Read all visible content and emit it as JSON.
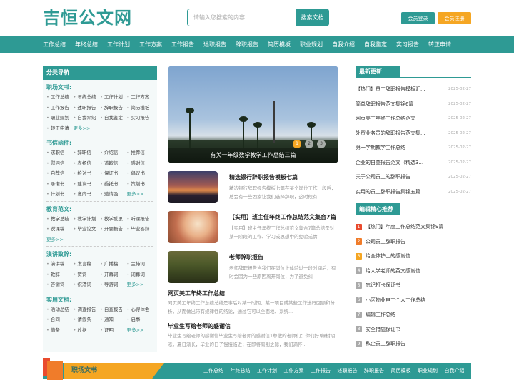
{
  "header": {
    "logo": "吉恒公文网",
    "search_placeholder": "请输入您搜索的内容",
    "search_button": "搜索文档",
    "login": "会员登录",
    "register": "会员注册"
  },
  "nav": [
    "工作总结",
    "年终总结",
    "工作计划",
    "工作方案",
    "工作报告",
    "述职报告",
    "辞职报告",
    "简历模板",
    "职业规划",
    "自我介绍",
    "自我鉴定",
    "实习报告",
    "转正申请"
  ],
  "sidebar": {
    "title": "分类导航",
    "categories": [
      {
        "title": "职场文书:",
        "items": [
          "工作总结",
          "年终总结",
          "工作计划",
          "工作方案",
          "工作报告",
          "述职报告",
          "辞职报告",
          "简历模板",
          "职业规划",
          "自我介绍",
          "自我鉴定",
          "实习报告",
          "转正申请",
          "更多>>"
        ]
      },
      {
        "title": "书信函件:",
        "items": [
          "求职信",
          "辞职信",
          "介绍信",
          "推荐信",
          "慰问信",
          "表扬信",
          "道歉信",
          "感谢信",
          "自荐信",
          "检讨书",
          "保证书",
          "倡议书",
          "承诺书",
          "建议书",
          "委托书",
          "策划书",
          "计划书",
          "意向书",
          "邀请函",
          "更多>>"
        ]
      },
      {
        "title": "教育范文:",
        "items": [
          "教学总结",
          "教学计划",
          "教学反思",
          "听课报告",
          "说课稿",
          "毕业论文",
          "开题报告",
          "毕业答辩",
          "更多>>"
        ]
      },
      {
        "title": "演讲致辞:",
        "items": [
          "演讲稿",
          "发言稿",
          "广播稿",
          "主持词",
          "致辞",
          "贺词",
          "开幕词",
          "闭幕词",
          "答谢词",
          "祝酒词",
          "导游词",
          "更多>>"
        ]
      },
      {
        "title": "实用文档:",
        "items": [
          "活动总结",
          "调查报告",
          "自查报告",
          "心得体会",
          "合同",
          "请假条",
          "通知",
          "启事",
          "借条",
          "收据",
          "证明",
          "更多>>"
        ]
      }
    ]
  },
  "slider": {
    "caption": "有关一年级数学教学工作总结三篇",
    "dots": [
      "1",
      "2",
      "3"
    ]
  },
  "articles": [
    {
      "title": "精选银行辞职报告模板七篇",
      "desc": "精选银行辞职报告模板七篇在某个岗位工作一段后，总会有一些因素让我们选择辞职，这时候有"
    },
    {
      "title": "【实用】班主任年终工作总结范文集合7篇",
      "desc": "【实用】班主任年终工作总结范文集合7篇总结是对某一阶段的工作、学习或思想中的经验或情"
    },
    {
      "title": "老师辞职报告",
      "desc": "老师辞职报告当我们在岗位上体验过一段时间后，有时会因为一些原因离开岗位，为了避免纠"
    }
  ],
  "text_articles": [
    {
      "title": "网页美工年终工作总结",
      "desc": "网页美工年终工作总结总结是事后对某一时期、某一项目或某些工作进行回顾和分析，从而做出带有规律性的结论，通过它可以全面地、系统..."
    },
    {
      "title": "毕业生写给老师的感谢信",
      "desc": "毕业生写给老师的感谢信毕业生写给老师的感谢信1尊敬的老师们：你们好!绿树阴浓，夏日渐长，毕业的日子慢慢临近；在即将离别之际，我们满怀..."
    }
  ],
  "latest": {
    "title": "最新更新",
    "items": [
      {
        "text": "【热门】员工辞职报告模板汇...",
        "date": "2025-02-27"
      },
      {
        "text": "简单辞职报告范文集锦6篇",
        "date": "2025-02-27"
      },
      {
        "text": "网页美工年终工作总结范文",
        "date": "2025-02-27"
      },
      {
        "text": "外贸业务员的辞职报告范文集...",
        "date": "2025-02-27"
      },
      {
        "text": "第一学期教学工作总结",
        "date": "2025-02-27"
      },
      {
        "text": "企业的自查报告范文（精选3...",
        "date": "2025-02-27"
      },
      {
        "text": "关于公司员工的辞职报告",
        "date": "2025-02-27"
      },
      {
        "text": "实用的员工辞职报告集锦五篇",
        "date": "2025-02-27"
      }
    ]
  },
  "recommend": {
    "title": "编辑精心推荐",
    "items": [
      {
        "num": "1",
        "text": "【热门】年度工作总结范文集锦9篇",
        "color": "#e94b2e"
      },
      {
        "num": "2",
        "text": "公司员工辞职报告",
        "color": "#f07c2a"
      },
      {
        "num": "3",
        "text": "给全体护士的感谢信",
        "color": "#f5a623"
      },
      {
        "num": "4",
        "text": "给大学老师的英文感谢信",
        "color": "#aaaaaa"
      },
      {
        "num": "5",
        "text": "忘记打卡保证书",
        "color": "#aaaaaa"
      },
      {
        "num": "6",
        "text": "小区物业电工个人工作总结",
        "color": "#aaaaaa"
      },
      {
        "num": "7",
        "text": "编辑工作总结",
        "color": "#aaaaaa"
      },
      {
        "num": "8",
        "text": "安全措施保证书",
        "color": "#aaaaaa"
      },
      {
        "num": "9",
        "text": "私企员工辞职报告",
        "color": "#aaaaaa"
      }
    ]
  },
  "bottom": {
    "label": "职场文书",
    "links": [
      "工作总结",
      "年终总结",
      "工作计划",
      "工作方案",
      "工作报告",
      "述职报告",
      "辞职报告",
      "简历模板",
      "职业规划",
      "自我介绍"
    ]
  },
  "colors": {
    "accent": "#2e9a94",
    "orange": "#f5a623",
    "red": "#e94b2e"
  }
}
